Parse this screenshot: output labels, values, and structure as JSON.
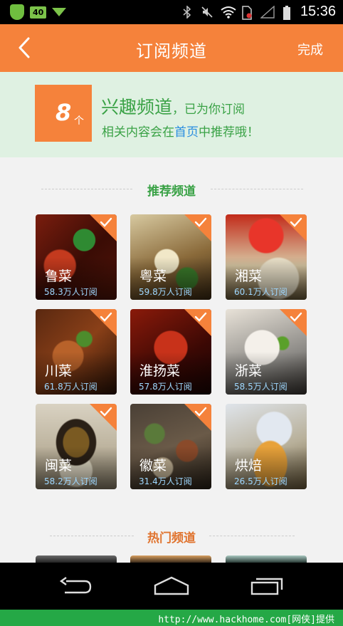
{
  "status_bar": {
    "time": "15:36",
    "notif_badge": "40",
    "icons": [
      "shield-app-icon",
      "download-icon",
      "bluetooth-icon",
      "mute-icon",
      "wifi-icon",
      "no-sim-icon",
      "signal-icon",
      "battery-icon"
    ]
  },
  "header": {
    "title": "订阅频道",
    "done_label": "完成",
    "back_icon": "back-chevron-icon"
  },
  "banner": {
    "count": "8",
    "count_unit": "个",
    "title": "兴趣频道",
    "title_suffix": "，已为你订阅",
    "line_prefix": "相关内容会在",
    "line_link": "首页",
    "line_suffix": "中推荐哦！"
  },
  "recommended": {
    "label": "推荐频道",
    "channels": [
      {
        "name": "鲁菜",
        "subscribers": "58.3万人订阅",
        "checked": true
      },
      {
        "name": "粤菜",
        "subscribers": "59.8万人订阅",
        "checked": true
      },
      {
        "name": "湘菜",
        "subscribers": "60.1万人订阅",
        "checked": true
      },
      {
        "name": "川菜",
        "subscribers": "61.8万人订阅",
        "checked": true
      },
      {
        "name": "淮扬菜",
        "subscribers": "57.8万人订阅",
        "checked": true
      },
      {
        "name": "浙菜",
        "subscribers": "58.5万人订阅",
        "checked": true
      },
      {
        "name": "闽菜",
        "subscribers": "58.2万人订阅",
        "checked": true
      },
      {
        "name": "徽菜",
        "subscribers": "31.4万人订阅",
        "checked": true
      },
      {
        "name": "烘焙",
        "subscribers": "26.5万人订阅",
        "checked": false
      }
    ]
  },
  "hot": {
    "label": "热门频道"
  },
  "footer": {
    "text": "http://www.hackhome.com[网侠]提供"
  },
  "colors": {
    "accent": "#f5823b",
    "green": "#3aa246",
    "banner_bg": "#dff1e2",
    "link": "#2a8ee0"
  }
}
